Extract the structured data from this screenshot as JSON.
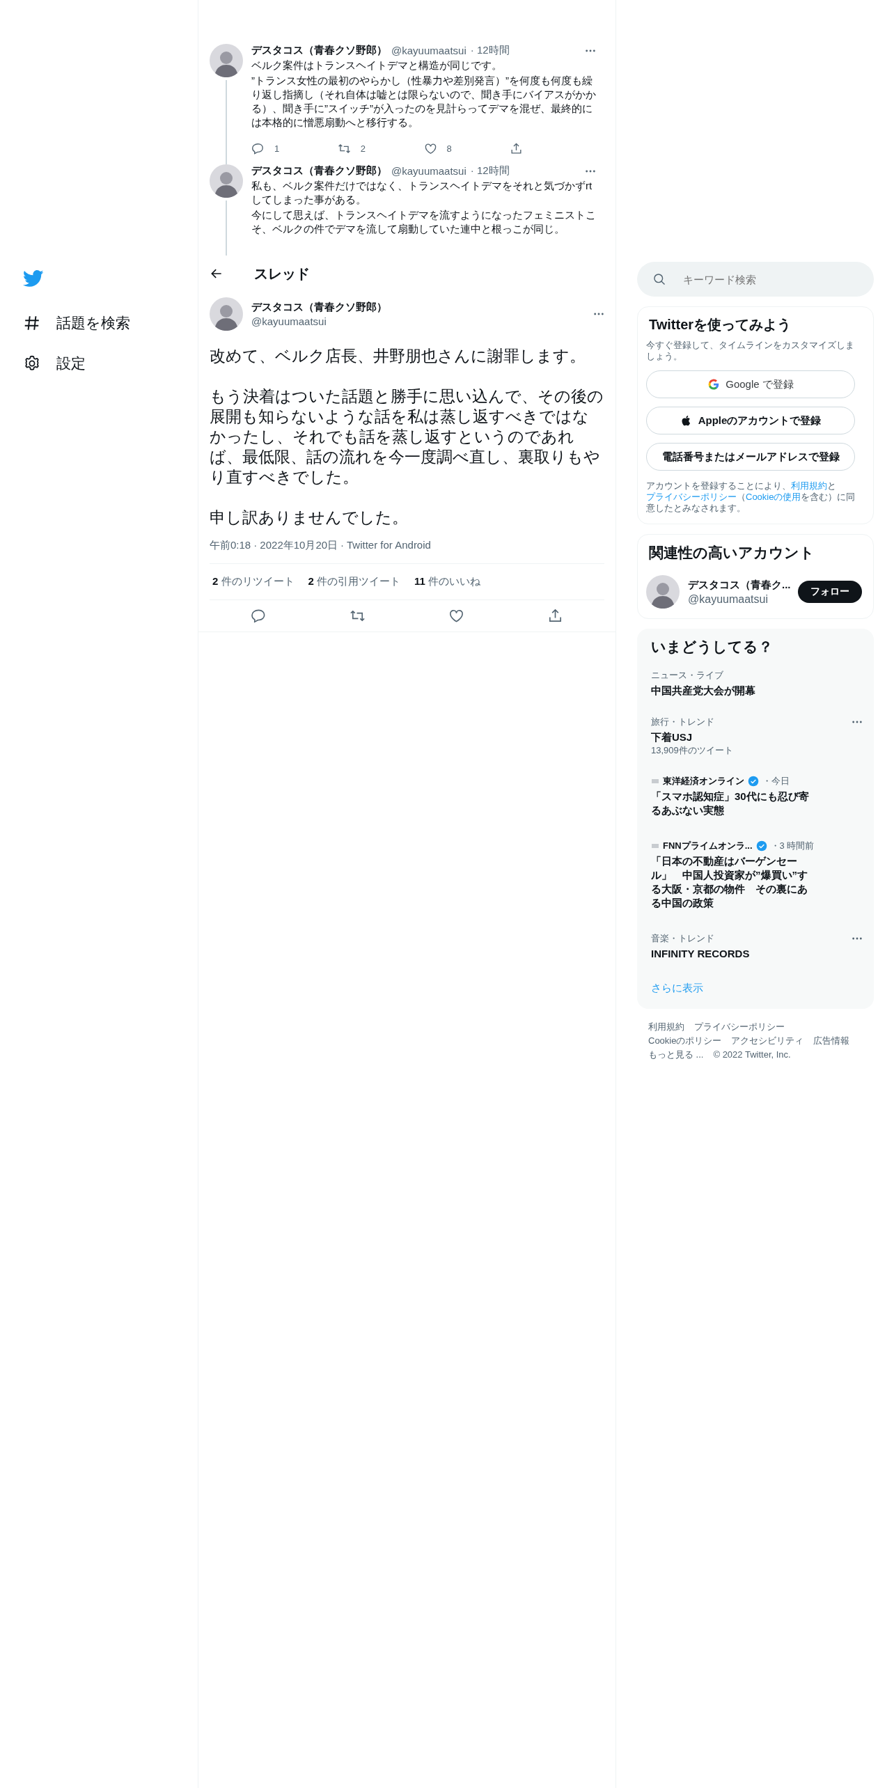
{
  "sidebar": {
    "nav": [
      {
        "kind": "explore",
        "label": "話題を検索"
      },
      {
        "kind": "settings",
        "label": "設定"
      }
    ]
  },
  "thread": [
    {
      "name": "デスタコス（青春クソ野郎）",
      "handle": "@kayuumaatsui",
      "time": "· 12時間",
      "paragraphs": [
        "ベルク案件はトランスヘイトデマと構造が同じです。",
        "”トランス女性の最初のやらかし（性暴力や差別発言）”を何度も何度も繰り返し指摘し（それ自体は嘘とは限らないので、聞き手にバイアスがかかる）、聞き手に”スイッチ”が入ったのを見計らってデマを混ぜ、最終的には本格的に憎悪扇動へと移行する。"
      ],
      "replies": "1",
      "retweets": "2",
      "likes": "8"
    },
    {
      "name": "デスタコス（青春クソ野郎）",
      "handle": "@kayuumaatsui",
      "time": "· 12時間",
      "paragraphs": [
        "私も、ベルク案件だけではなく、トランスヘイトデマをそれと気づかずrtしてしまった事がある。",
        "今にして思えば、トランスヘイトデマを流すようになったフェミニストこそ、ベルクの件でデマを流して扇動していた連中と根っこが同じ。"
      ]
    }
  ],
  "header": {
    "title": "スレッド"
  },
  "tweet": {
    "name": "デスタコス（青春クソ野郎）",
    "handle": "@kayuumaatsui",
    "paragraphs": [
      "改めて、ベルク店長、井野朋也さんに謝罪します。",
      "もう決着はついた話題と勝手に思い込んで、その後の展開も知らないような話を私は蒸し返すべきではなかったし、それでも話を蒸し返すというのであれば、最低限、話の流れを今一度調べ直し、裏取りもやり直すべきでした。",
      "申し訳ありませんでした。"
    ],
    "time": "午前0:18",
    "date": "· 2022年10月20日",
    "source": "· Twitter for Android",
    "stats": [
      {
        "count": "2",
        "label": "件のリツイート"
      },
      {
        "count": "2",
        "label": "件の引用ツイート"
      },
      {
        "count": "11",
        "label": "件のいいね"
      }
    ]
  },
  "search": {
    "placeholder": "キーワード検索"
  },
  "signup": {
    "title": "Twitterを使ってみよう",
    "subtitle": "今すぐ登録して、タイムラインをカスタマイズしましょう。",
    "buttons": [
      {
        "kind": "google",
        "label": "Google で登録"
      },
      {
        "kind": "apple",
        "label": "Appleのアカウントで登録"
      },
      {
        "kind": "plain",
        "label": "電話番号またはメールアドレスで登録"
      }
    ],
    "legal": [
      {
        "kind": "text",
        "text": "アカウントを登録することにより、"
      },
      {
        "kind": "link",
        "text": "利用規約"
      },
      {
        "kind": "text",
        "text": "と"
      },
      {
        "kind": "link",
        "text": "プライバシーポリシー"
      },
      {
        "kind": "text",
        "text": "（"
      },
      {
        "kind": "link",
        "text": "Cookieの使用"
      },
      {
        "kind": "text",
        "text": "を含む）に同意したとみなされます。"
      }
    ]
  },
  "related": {
    "title": "関連性の高いアカウント",
    "name": "デスタコス（青春ク...",
    "handle": "@kayuumaatsui",
    "button": "フォロー"
  },
  "trends": {
    "title": "いまどうしてる？",
    "items": [
      {
        "kind": "trend",
        "meta": "ニュース・ライブ",
        "title": "中国共産党大会が開幕",
        "more": false
      },
      {
        "kind": "trend",
        "meta": "旅行・トレンド",
        "title": "下着USJ",
        "count": "13,909件のツイート",
        "more": true
      },
      {
        "kind": "news",
        "source": "東洋経済オンライン",
        "verified": true,
        "time": "・今日",
        "title": "「スマホ認知症」30代にも忍び寄るあぶない実態"
      },
      {
        "kind": "news",
        "source": "FNNプライムオンラ...",
        "verified": true,
        "time": "・3 時間前",
        "title": "「日本の不動産はバーゲンセール」　中国人投資家が”爆買い”する大阪・京都の物件　その裏にある中国の政策"
      },
      {
        "kind": "trend",
        "meta": "音楽・トレンド",
        "title": "INFINITY RECORDS",
        "more": true
      }
    ],
    "show_more": "さらに表示"
  },
  "footer": {
    "rows": [
      [
        "利用規約",
        "プライバシーポリシー"
      ],
      [
        "Cookieのポリシー",
        "アクセシビリティ",
        "広告情報"
      ],
      [
        "もっと見る ...",
        "© 2022 Twitter, Inc."
      ]
    ]
  }
}
